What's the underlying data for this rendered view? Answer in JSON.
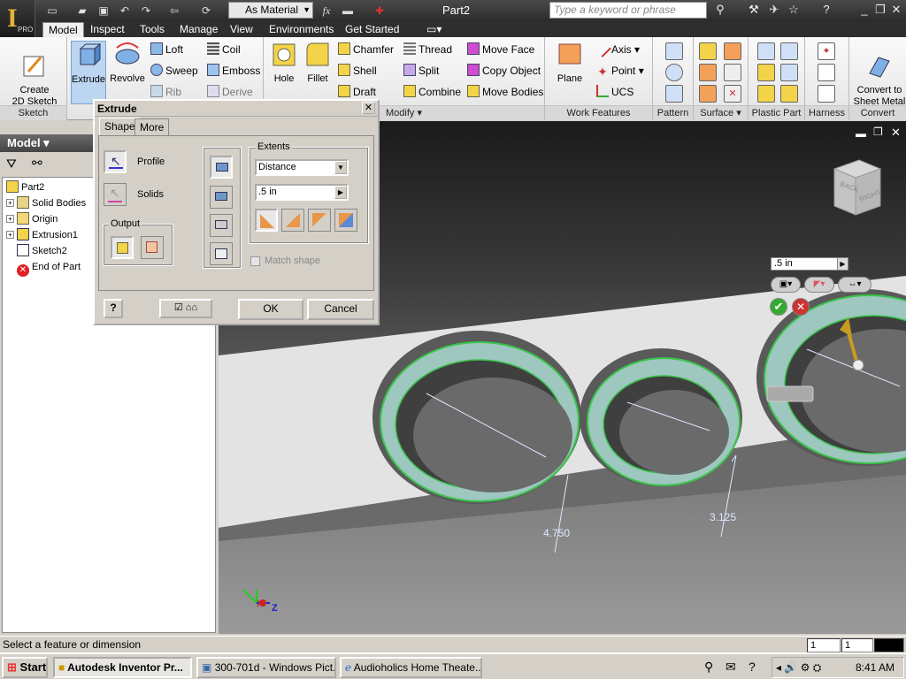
{
  "app": {
    "pro_label": "PRO",
    "doc_title": "Part2",
    "material": "As Material",
    "search_placeholder": "Type a keyword or phrase"
  },
  "tabs": [
    "Model",
    "Inspect",
    "Tools",
    "Manage",
    "View",
    "Environments",
    "Get Started"
  ],
  "active_tab": "Model",
  "ribbon": {
    "sketch": {
      "create_label": "Create\n2D Sketch",
      "panel": "Sketch"
    },
    "create": {
      "extrude": "Extrude",
      "revolve": "Revolve",
      "loft": "Loft",
      "sweep": "Sweep",
      "rib": "Rib",
      "coil": "Coil",
      "emboss": "Emboss",
      "derive": "Derive"
    },
    "modify": {
      "hole": "Hole",
      "fillet": "Fillet",
      "chamfer": "Chamfer",
      "shell": "Shell",
      "draft": "Draft",
      "thread": "Thread",
      "split": "Split",
      "combine": "Combine",
      "move_face": "Move Face",
      "copy_object": "Copy Object",
      "move_bodies": "Move Bodies",
      "panel": "Modify"
    },
    "work_features": {
      "plane": "Plane",
      "axis": "Axis",
      "point": "Point",
      "ucs": "UCS",
      "panel": "Work Features"
    },
    "panels": {
      "pattern": "Pattern",
      "surface": "Surface",
      "plastic_part": "Plastic Part",
      "harness": "Harness",
      "convert": "Convert"
    },
    "convert_btn": "Convert to\nSheet Metal"
  },
  "browser": {
    "title": "Model",
    "items": [
      {
        "label": "Part2"
      },
      {
        "label": "Solid Bodies"
      },
      {
        "label": "Origin"
      },
      {
        "label": "Extrusion1"
      },
      {
        "label": "Sketch2"
      },
      {
        "label": "End of Part"
      }
    ]
  },
  "dialog": {
    "title": "Extrude",
    "tabs": [
      "Shape",
      "More"
    ],
    "profile": "Profile",
    "solids": "Solids",
    "output": "Output",
    "extents": "Extents",
    "extent_type": "Distance",
    "distance": ".5 in",
    "match_shape": "Match shape",
    "ok": "OK",
    "cancel": "Cancel"
  },
  "viewport": {
    "minibar_value": ".5 in",
    "dim1": "4.750",
    "dim2": "3.125",
    "viewcube_labels": [
      "BACK",
      "RIGHT"
    ]
  },
  "status": {
    "text": "Select a feature or dimension",
    "field1": "1",
    "field2": "1"
  },
  "taskbar": {
    "start": "Start",
    "items": [
      "Autodesk Inventor Pr...",
      "300-701d - Windows Pict...",
      "Audioholics Home Theate..."
    ],
    "time": "8:41 AM"
  },
  "colors": {
    "accent": "#e6b23c",
    "highlight": "#8fd6a8",
    "selection": "#3d9bdb"
  }
}
